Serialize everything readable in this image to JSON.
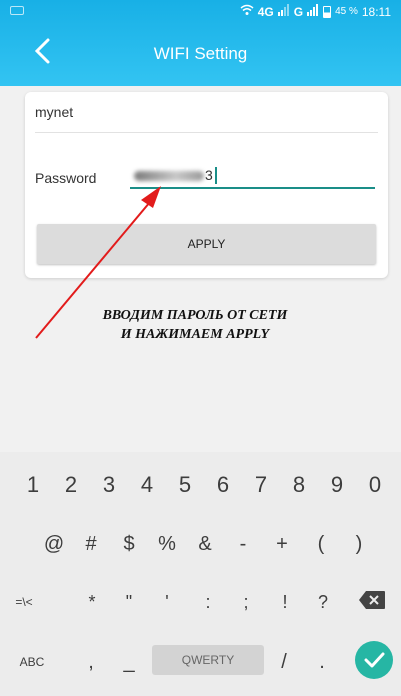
{
  "status": {
    "network": "4G",
    "network2": "G",
    "battery": "45 %",
    "time": "18:11"
  },
  "header": {
    "title": "WIFI Setting",
    "back_icon": "chevron-left-icon"
  },
  "form": {
    "ssid": "mynet",
    "password_label": "Password",
    "password_visible_suffix": "3",
    "apply_label": "APPLY"
  },
  "annotation": {
    "line1": "ВВОДИМ ПАРОЛЬ ОТ СЕТИ",
    "line2": "И НАЖИМАЕМ APPLY",
    "arrow_color": "#e21b1b"
  },
  "keyboard": {
    "row1": [
      "1",
      "2",
      "3",
      "4",
      "5",
      "6",
      "7",
      "8",
      "9",
      "0"
    ],
    "row2": [
      "@",
      "#",
      "$",
      "%",
      "&",
      "-",
      "+",
      "(",
      ")"
    ],
    "row3": [
      "=\\<",
      "*",
      "\"",
      "'",
      ":",
      ";",
      "!",
      "?"
    ],
    "row4": {
      "abc": "ABC",
      "comma": ",",
      "underscore": "_",
      "space": "QWERTY",
      "slash": "/",
      "period": "."
    },
    "enter_color": "#26b6a4"
  },
  "colors": {
    "appbar": "#1fb7eb",
    "accent": "#1a8e88"
  }
}
